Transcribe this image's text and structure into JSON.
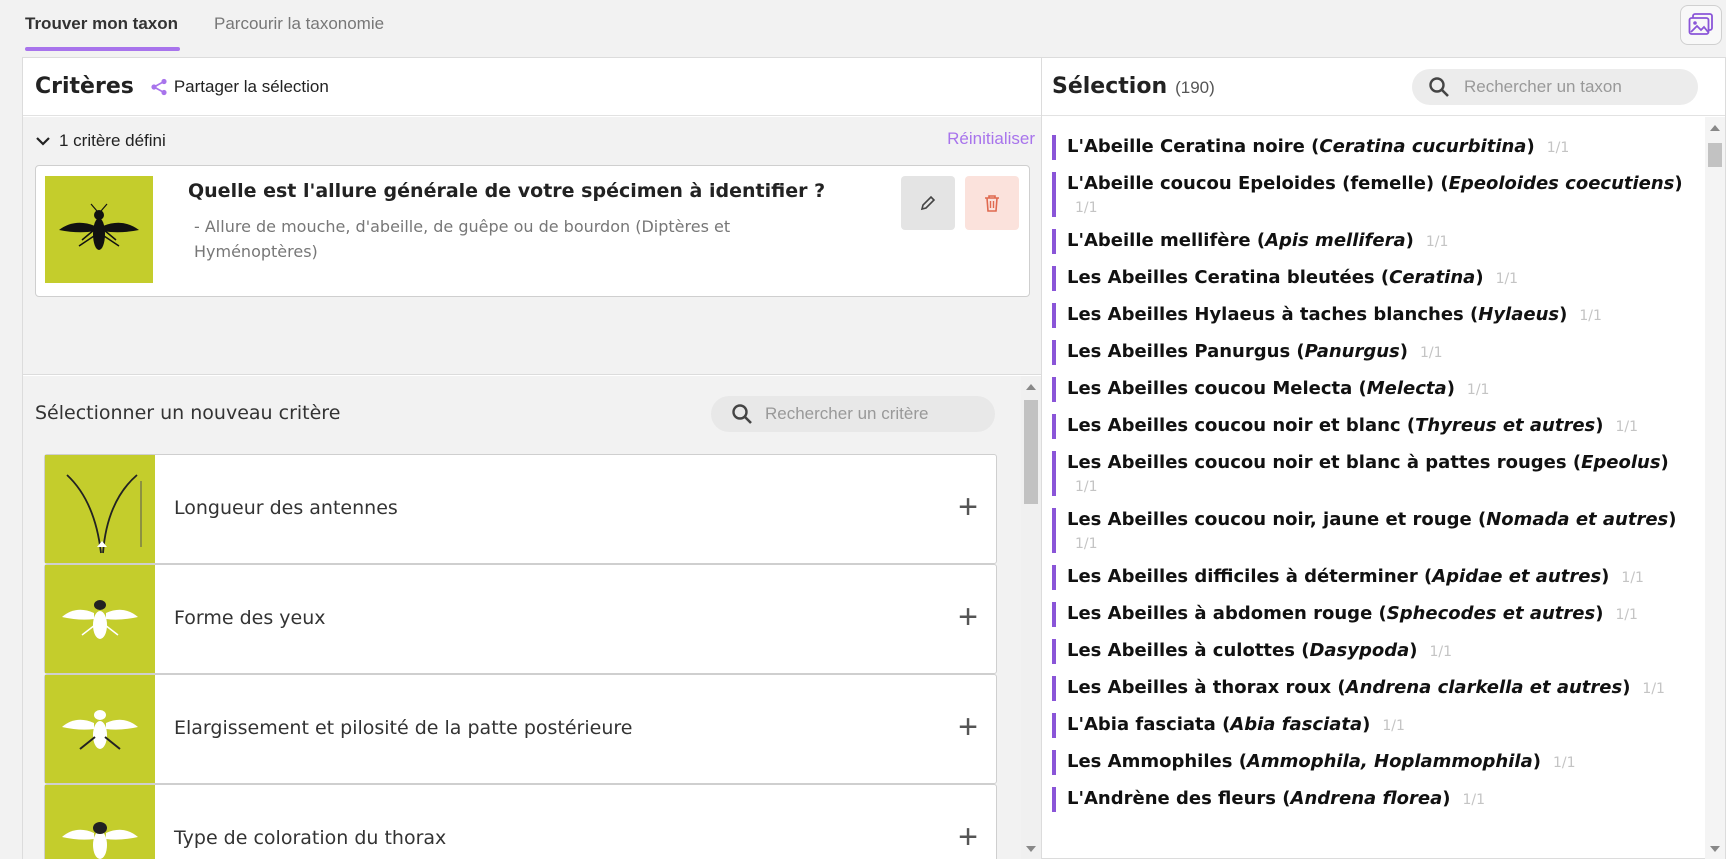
{
  "tabs": {
    "active": "Trouver mon taxon",
    "inactive": "Parcourir la taxonomie",
    "gallery_icon": "image-gallery-icon"
  },
  "left": {
    "title": "Critères",
    "share_label": "Partager la sélection",
    "defined_label": "1 critère défini",
    "reset_label": "Réinitialiser",
    "defined_criterion": {
      "question": "Quelle est l'allure générale de votre spécimen à identifier ?",
      "answer": "- Allure de mouche, d'abeille, de guêpe ou de bourdon (Diptères et Hyménoptères)"
    },
    "new_label": "Sélectionner un nouveau critère",
    "search_placeholder": "Rechercher un critère",
    "criteria": [
      {
        "label": "Longueur des antennes"
      },
      {
        "label": "Forme des yeux"
      },
      {
        "label": "Elargissement et pilosité de la patte postérieure"
      },
      {
        "label": "Type de coloration du thorax"
      }
    ]
  },
  "right": {
    "title": "Sélection",
    "count": "(190)",
    "search_placeholder": "Rechercher un taxon",
    "taxa": [
      {
        "name": "L'Abeille Ceratina noire (",
        "sci": "Ceratina cucurbitina",
        "end": ")",
        "frac": "1/1"
      },
      {
        "name": "L'Abeille coucou Epeloides (femelle) (",
        "sci": "Epeoloides coecutiens",
        "end": ")",
        "frac": "1/1"
      },
      {
        "name": "L'Abeille mellifère (",
        "sci": "Apis mellifera",
        "end": ")",
        "frac": "1/1"
      },
      {
        "name": "Les Abeilles Ceratina bleutées (",
        "sci": "Ceratina",
        "end": ")",
        "frac": "1/1"
      },
      {
        "name": "Les Abeilles Hylaeus à taches blanches (",
        "sci": "Hylaeus",
        "end": ")",
        "frac": "1/1"
      },
      {
        "name": "Les Abeilles Panurgus (",
        "sci": "Panurgus",
        "end": ")",
        "frac": "1/1"
      },
      {
        "name": "Les Abeilles coucou Melecta (",
        "sci": "Melecta",
        "end": ")",
        "frac": "1/1"
      },
      {
        "name": "Les Abeilles coucou noir et blanc (",
        "sci": "Thyreus et autres",
        "end": ")",
        "frac": "1/1"
      },
      {
        "name": "Les Abeilles coucou noir et blanc à pattes rouges (",
        "sci": "Epeolus",
        "end": ")",
        "frac": "1/1"
      },
      {
        "name": "Les Abeilles coucou noir, jaune et rouge (",
        "sci": "Nomada et autres",
        "end": ")",
        "frac": "1/1"
      },
      {
        "name": "Les Abeilles difficiles à déterminer (",
        "sci": "Apidae et autres",
        "end": ")",
        "frac": "1/1"
      },
      {
        "name": "Les Abeilles à abdomen rouge (",
        "sci": "Sphecodes et autres",
        "end": ")",
        "frac": "1/1"
      },
      {
        "name": "Les Abeilles à culottes (",
        "sci": "Dasypoda",
        "end": ")",
        "frac": "1/1"
      },
      {
        "name": "Les Abeilles à thorax roux (",
        "sci": "Andrena clarkella et autres",
        "end": ")",
        "frac": "1/1"
      },
      {
        "name": "L'Abia fasciata (",
        "sci": "Abia fasciata",
        "end": ")",
        "frac": "1/1"
      },
      {
        "name": "Les Ammophiles (",
        "sci": "Ammophila, Hoplammophila",
        "end": ")",
        "frac": "1/1"
      },
      {
        "name": "L'Andrène des fleurs (",
        "sci": "Andrena florea",
        "end": ")",
        "frac": "1/1"
      }
    ]
  },
  "colors": {
    "accent": "#a874ec",
    "taxon_bar": "#8a55d8",
    "thumb_bg": "#c4cd2c",
    "delete_bg": "#fbe2dc"
  }
}
